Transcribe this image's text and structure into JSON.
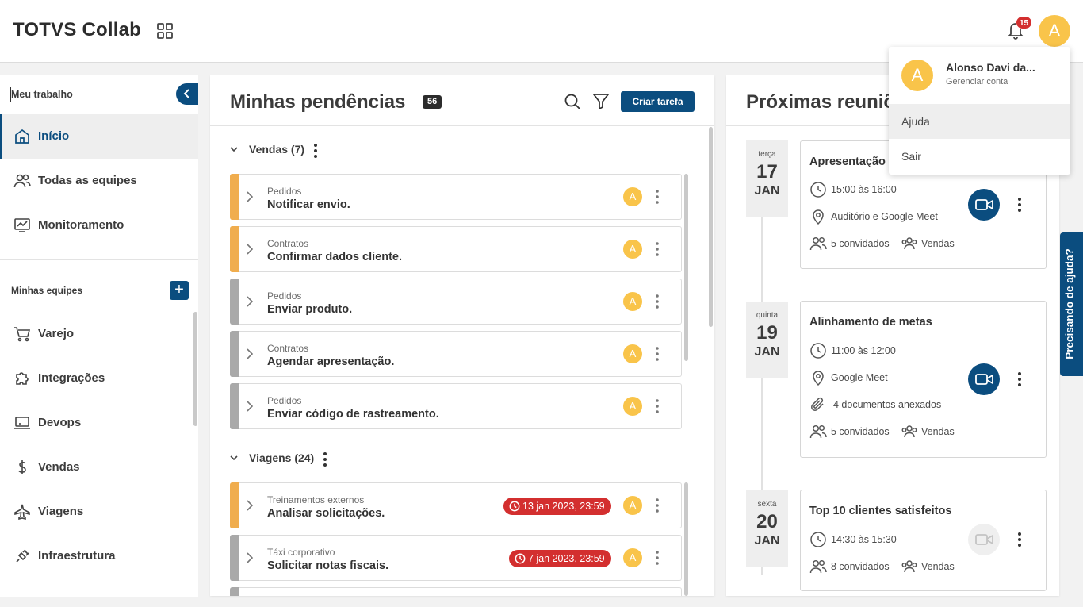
{
  "header": {
    "brand": "TOTVS Collab",
    "notifications_count": "15",
    "avatar_initial": "A"
  },
  "sidebar": {
    "section_title": "Meu trabalho",
    "items": [
      {
        "label": "Início",
        "icon": "home-icon",
        "active": true
      },
      {
        "label": "Todas as equipes",
        "icon": "users-icon"
      },
      {
        "label": "Monitoramento",
        "icon": "monitor-chart-icon"
      }
    ],
    "teams_title": "Minhas equipes",
    "teams": [
      {
        "label": "Varejo",
        "icon": "cart-icon"
      },
      {
        "label": "Integrações",
        "icon": "puzzle-icon"
      },
      {
        "label": "Devops",
        "icon": "laptop-icon"
      },
      {
        "label": "Vendas",
        "icon": "dollar-icon"
      },
      {
        "label": "Viagens",
        "icon": "airplane-icon"
      },
      {
        "label": "Infraestrutura",
        "icon": "plug-icon"
      }
    ]
  },
  "pendencias": {
    "title": "Minhas pendências",
    "count": "56",
    "create_label": "Criar tarefa",
    "groups": [
      {
        "name": "Vendas (7)",
        "tasks": [
          {
            "category": "Pedidos",
            "name": "Notificar envio.",
            "status": "orange",
            "avatar": "A"
          },
          {
            "category": "Contratos",
            "name": "Confirmar dados cliente.",
            "status": "orange",
            "avatar": "A"
          },
          {
            "category": "Pedidos",
            "name": "Enviar produto.",
            "status": "gray",
            "avatar": "A"
          },
          {
            "category": "Contratos",
            "name": "Agendar apresentação.",
            "status": "gray",
            "avatar": "A"
          },
          {
            "category": "Pedidos",
            "name": "Enviar código de rastreamento.",
            "status": "gray",
            "avatar": "A"
          }
        ]
      },
      {
        "name": "Viagens (24)",
        "tasks": [
          {
            "category": "Treinamentos externos",
            "name": "Analisar solicitações.",
            "status": "orange",
            "due": "13 jan 2023, 23:59",
            "avatar": "A"
          },
          {
            "category": "Táxi corporativo",
            "name": "Solicitar notas fiscais.",
            "status": "gray",
            "due": "7 jan 2023, 23:59",
            "avatar": "A"
          }
        ]
      }
    ]
  },
  "reunioes": {
    "title": "Próximas reuniões",
    "meetings": [
      {
        "dow": "terça",
        "day": "17",
        "month": "JAN",
        "title": "Apresentação",
        "time": "15:00 às 16:00",
        "location": "Auditório e Google Meet",
        "guests": "5 convidados",
        "team": "Vendas",
        "video": true
      },
      {
        "dow": "quinta",
        "day": "19",
        "month": "JAN",
        "title": "Alinhamento de metas",
        "time": "11:00 às 12:00",
        "location": "Google Meet",
        "attachments": "4 documentos anexados",
        "guests": "5 convidados",
        "team": "Vendas",
        "video": true
      },
      {
        "dow": "sexta",
        "day": "20",
        "month": "JAN",
        "title": "Top 10 clientes satisfeitos",
        "time": "14:30 às 15:30",
        "guests": "8 convidados",
        "team": "Vendas",
        "video": false
      }
    ]
  },
  "help_tab": "Precisando de ajuda?",
  "profile_menu": {
    "initial": "A",
    "name": "Alonso Davi da...",
    "manage": "Gerenciar conta",
    "items": [
      "Ajuda",
      "Sair"
    ]
  },
  "colors": {
    "primary": "#0b4d7f",
    "avatar": "#f9c44a",
    "overdue": "#d32f2f",
    "status_orange": "#f0ad4e",
    "status_gray": "#a9a9a9",
    "notification_badge": "#d32f2f"
  }
}
